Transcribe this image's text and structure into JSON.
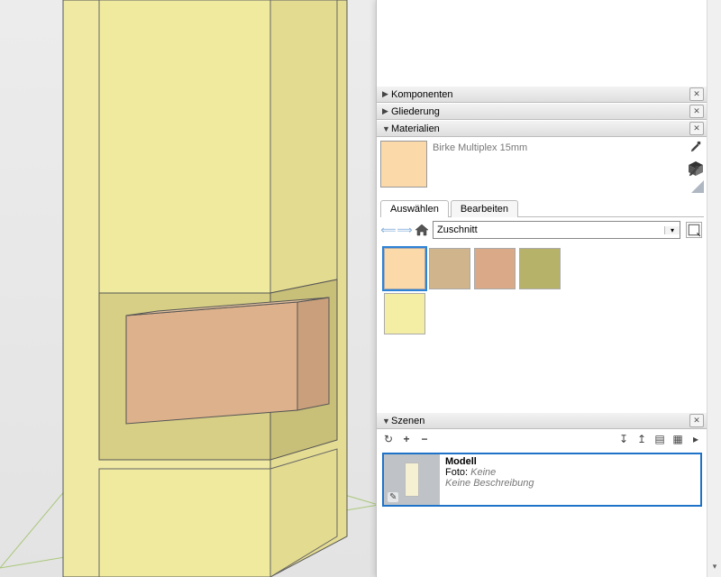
{
  "panels": {
    "komponenten": {
      "title": "Komponenten",
      "expanded": false
    },
    "gliederung": {
      "title": "Gliederung",
      "expanded": false
    },
    "materialien": {
      "title": "Materialien",
      "expanded": true
    },
    "szenen": {
      "title": "Szenen",
      "expanded": true
    }
  },
  "materials": {
    "current_name": "Birke Multiplex 15mm",
    "tabs": {
      "select": "Auswählen",
      "edit": "Bearbeiten"
    },
    "library": "Zuschnitt",
    "swatches": [
      {
        "name": "Birke Multiplex 15mm",
        "color": "#fcd9a8",
        "selected": true
      },
      {
        "name": "mat-2",
        "color": "#cfb48c",
        "selected": false
      },
      {
        "name": "mat-3",
        "color": "#d9a988",
        "selected": false
      },
      {
        "name": "mat-4",
        "color": "#b7b26a",
        "selected": false
      },
      {
        "name": "mat-5",
        "color": "#f3eea4",
        "selected": false
      }
    ]
  },
  "scenes": {
    "item": {
      "name": "Modell",
      "photo_label": "Foto:",
      "photo_value": "Keine",
      "description": "Keine Beschreibung"
    }
  }
}
